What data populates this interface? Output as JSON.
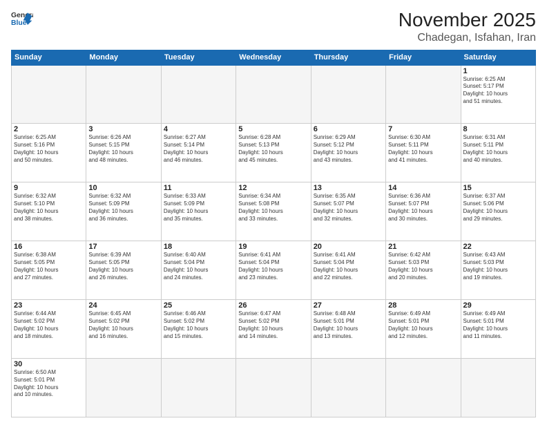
{
  "header": {
    "logo_general": "General",
    "logo_blue": "Blue",
    "title": "November 2025",
    "subtitle": "Chadegan, Isfahan, Iran"
  },
  "weekdays": [
    "Sunday",
    "Monday",
    "Tuesday",
    "Wednesday",
    "Thursday",
    "Friday",
    "Saturday"
  ],
  "weeks": [
    [
      {
        "day": "",
        "info": ""
      },
      {
        "day": "",
        "info": ""
      },
      {
        "day": "",
        "info": ""
      },
      {
        "day": "",
        "info": ""
      },
      {
        "day": "",
        "info": ""
      },
      {
        "day": "",
        "info": ""
      },
      {
        "day": "1",
        "info": "Sunrise: 6:25 AM\nSunset: 5:17 PM\nDaylight: 10 hours\nand 51 minutes."
      }
    ],
    [
      {
        "day": "2",
        "info": "Sunrise: 6:25 AM\nSunset: 5:16 PM\nDaylight: 10 hours\nand 50 minutes."
      },
      {
        "day": "3",
        "info": "Sunrise: 6:26 AM\nSunset: 5:15 PM\nDaylight: 10 hours\nand 48 minutes."
      },
      {
        "day": "4",
        "info": "Sunrise: 6:27 AM\nSunset: 5:14 PM\nDaylight: 10 hours\nand 46 minutes."
      },
      {
        "day": "5",
        "info": "Sunrise: 6:28 AM\nSunset: 5:13 PM\nDaylight: 10 hours\nand 45 minutes."
      },
      {
        "day": "6",
        "info": "Sunrise: 6:29 AM\nSunset: 5:12 PM\nDaylight: 10 hours\nand 43 minutes."
      },
      {
        "day": "7",
        "info": "Sunrise: 6:30 AM\nSunset: 5:11 PM\nDaylight: 10 hours\nand 41 minutes."
      },
      {
        "day": "8",
        "info": "Sunrise: 6:31 AM\nSunset: 5:11 PM\nDaylight: 10 hours\nand 40 minutes."
      }
    ],
    [
      {
        "day": "9",
        "info": "Sunrise: 6:32 AM\nSunset: 5:10 PM\nDaylight: 10 hours\nand 38 minutes."
      },
      {
        "day": "10",
        "info": "Sunrise: 6:32 AM\nSunset: 5:09 PM\nDaylight: 10 hours\nand 36 minutes."
      },
      {
        "day": "11",
        "info": "Sunrise: 6:33 AM\nSunset: 5:09 PM\nDaylight: 10 hours\nand 35 minutes."
      },
      {
        "day": "12",
        "info": "Sunrise: 6:34 AM\nSunset: 5:08 PM\nDaylight: 10 hours\nand 33 minutes."
      },
      {
        "day": "13",
        "info": "Sunrise: 6:35 AM\nSunset: 5:07 PM\nDaylight: 10 hours\nand 32 minutes."
      },
      {
        "day": "14",
        "info": "Sunrise: 6:36 AM\nSunset: 5:07 PM\nDaylight: 10 hours\nand 30 minutes."
      },
      {
        "day": "15",
        "info": "Sunrise: 6:37 AM\nSunset: 5:06 PM\nDaylight: 10 hours\nand 29 minutes."
      }
    ],
    [
      {
        "day": "16",
        "info": "Sunrise: 6:38 AM\nSunset: 5:05 PM\nDaylight: 10 hours\nand 27 minutes."
      },
      {
        "day": "17",
        "info": "Sunrise: 6:39 AM\nSunset: 5:05 PM\nDaylight: 10 hours\nand 26 minutes."
      },
      {
        "day": "18",
        "info": "Sunrise: 6:40 AM\nSunset: 5:04 PM\nDaylight: 10 hours\nand 24 minutes."
      },
      {
        "day": "19",
        "info": "Sunrise: 6:41 AM\nSunset: 5:04 PM\nDaylight: 10 hours\nand 23 minutes."
      },
      {
        "day": "20",
        "info": "Sunrise: 6:41 AM\nSunset: 5:04 PM\nDaylight: 10 hours\nand 22 minutes."
      },
      {
        "day": "21",
        "info": "Sunrise: 6:42 AM\nSunset: 5:03 PM\nDaylight: 10 hours\nand 20 minutes."
      },
      {
        "day": "22",
        "info": "Sunrise: 6:43 AM\nSunset: 5:03 PM\nDaylight: 10 hours\nand 19 minutes."
      }
    ],
    [
      {
        "day": "23",
        "info": "Sunrise: 6:44 AM\nSunset: 5:02 PM\nDaylight: 10 hours\nand 18 minutes."
      },
      {
        "day": "24",
        "info": "Sunrise: 6:45 AM\nSunset: 5:02 PM\nDaylight: 10 hours\nand 16 minutes."
      },
      {
        "day": "25",
        "info": "Sunrise: 6:46 AM\nSunset: 5:02 PM\nDaylight: 10 hours\nand 15 minutes."
      },
      {
        "day": "26",
        "info": "Sunrise: 6:47 AM\nSunset: 5:02 PM\nDaylight: 10 hours\nand 14 minutes."
      },
      {
        "day": "27",
        "info": "Sunrise: 6:48 AM\nSunset: 5:01 PM\nDaylight: 10 hours\nand 13 minutes."
      },
      {
        "day": "28",
        "info": "Sunrise: 6:49 AM\nSunset: 5:01 PM\nDaylight: 10 hours\nand 12 minutes."
      },
      {
        "day": "29",
        "info": "Sunrise: 6:49 AM\nSunset: 5:01 PM\nDaylight: 10 hours\nand 11 minutes."
      }
    ],
    [
      {
        "day": "30",
        "info": "Sunrise: 6:50 AM\nSunset: 5:01 PM\nDaylight: 10 hours\nand 10 minutes."
      },
      {
        "day": "",
        "info": ""
      },
      {
        "day": "",
        "info": ""
      },
      {
        "day": "",
        "info": ""
      },
      {
        "day": "",
        "info": ""
      },
      {
        "day": "",
        "info": ""
      },
      {
        "day": "",
        "info": ""
      }
    ]
  ]
}
